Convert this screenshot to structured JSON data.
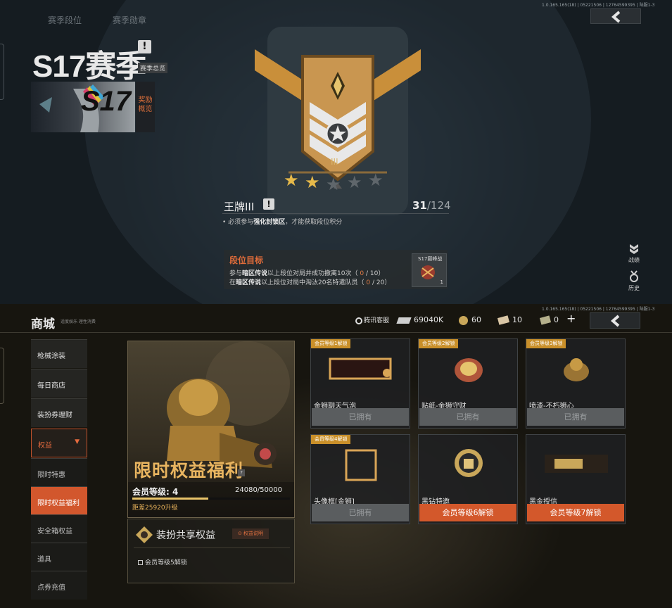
{
  "season": {
    "version_top": "1.0.165.165(18) | 05221506 | 12764599395 | 陆服1-3",
    "tabs": [
      "赛季段位",
      "赛季勋章"
    ],
    "title": "S17赛季",
    "overview_label": "赛季总览",
    "card_label": "S17",
    "reward_overview": "奖励概览",
    "rank_name": "王牌III",
    "rank_points": "31",
    "rank_total": "/124",
    "rank_roman": "III",
    "rank_note_prefix": "必须参与",
    "rank_note_highlight": "强化封锁区",
    "rank_note_suffix": "，才能获取段位积分",
    "goal": {
      "title": "段位目标",
      "line1_a": "参与",
      "line1_b": "暗区传说",
      "line1_c": "以上段位对局并成功撤离10次（",
      "line1_prog": "0",
      "line1_total": "/ 10",
      "line1_end": "）",
      "line2_a": "在",
      "line2_b": "暗区传说",
      "line2_c": "以上段位对局中淘汰20名特遣队员（",
      "line2_prog": "0",
      "line2_total": "/ 20",
      "line2_end": "）",
      "reward_name": "S17巅峰战",
      "reward_qty": "1"
    },
    "side_buttons": [
      {
        "label": "战绩",
        "icon": "rank-chevron-icon"
      },
      {
        "label": "历史",
        "icon": "history-medal-icon"
      }
    ],
    "stars_filled": 2,
    "stars_total": 5
  },
  "shop": {
    "version": "1.0.165.165(18) | 05221506 | 12764599395 | 陆服1-3",
    "title": "商城",
    "subtitle": "适度娱乐 理性消费",
    "service": "腾讯客服",
    "currencies": [
      {
        "icon": "coin-stack-icon",
        "value": "69040K"
      },
      {
        "icon": "gold-coin-icon",
        "value": "60"
      },
      {
        "icon": "ticket-icon",
        "value": "10"
      },
      {
        "icon": "voucher-icon",
        "value": "0"
      }
    ],
    "add_label": "+",
    "sidebar": [
      {
        "label": "枪械涂装",
        "type": "main"
      },
      {
        "label": "每日商店",
        "type": "main"
      },
      {
        "label": "装扮券理财",
        "type": "main"
      },
      {
        "label": "权益",
        "type": "expanded"
      },
      {
        "label": "限时特惠",
        "type": "sub"
      },
      {
        "label": "限时权益福利",
        "type": "active"
      },
      {
        "label": "安全箱权益",
        "type": "sub"
      },
      {
        "label": "道具",
        "type": "sub"
      },
      {
        "label": "点券充值",
        "type": "sub"
      }
    ],
    "hero": {
      "title": "限时权益福利",
      "help": "?",
      "level_label": "会员等级: 4",
      "level_value": "24080/50000",
      "level_progress": 0.4816,
      "upgrade_note": "距差25920升级"
    },
    "share": {
      "title": "装扮共享权益",
      "button": "权益说明",
      "lock_text": "会员等级5解锁"
    },
    "cards": [
      {
        "badge": "会员等级1解锁",
        "name": "金狮聊天气泡",
        "button": "已拥有",
        "state": "owned",
        "thumb": "bubble"
      },
      {
        "badge": "会员等级2解锁",
        "name": "贴纸-金狮守财",
        "button": "已拥有",
        "state": "owned",
        "thumb": "sticker"
      },
      {
        "badge": "会员等级3解锁",
        "name": "喷漆-不朽狮心",
        "button": "已拥有",
        "state": "owned",
        "thumb": "spray"
      },
      {
        "badge": "会员等级4解锁",
        "name": "头像框[金狮]",
        "button": "已拥有",
        "state": "owned",
        "thumb": "frame"
      },
      {
        "badge": "",
        "name": "黑钻特邀",
        "button": "会员等级6解锁",
        "state": "locked",
        "thumb": "helmet"
      },
      {
        "badge": "",
        "name": "黑金授信",
        "button": "会员等级7解锁",
        "state": "locked",
        "thumb": "card"
      }
    ],
    "colors": {
      "accent": "#d3582b",
      "gold": "#e9b560",
      "badge": "#c98f29"
    }
  }
}
